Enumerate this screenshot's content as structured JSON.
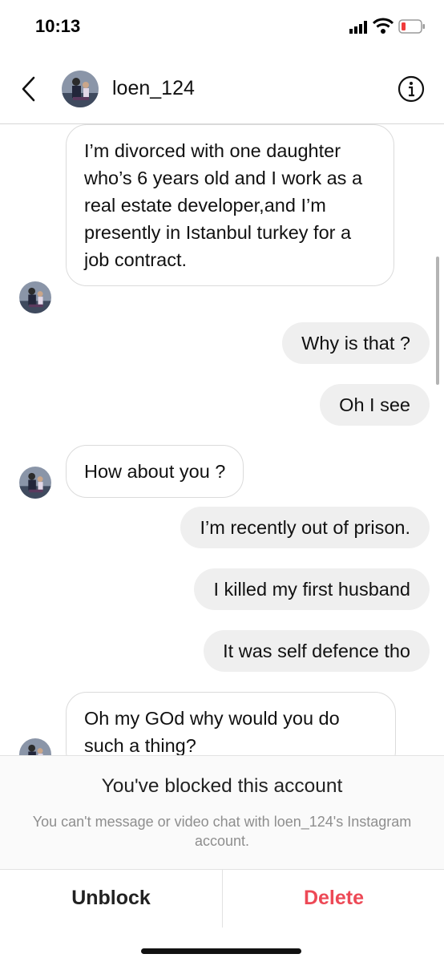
{
  "status_bar": {
    "time": "10:13",
    "icons": [
      "signal-icon",
      "wifi-icon",
      "battery-low-icon"
    ],
    "battery_color": "#f03b3b"
  },
  "header": {
    "username": "loen_124",
    "back_icon": "chevron-left-icon",
    "info_icon": "info-icon"
  },
  "messages": [
    {
      "from": "them",
      "text": "I’m divorced with one daughter who’s 6 years old and I work as a  real estate developer,and I’m presently in Istanbul turkey for a job contract."
    },
    {
      "from": "me",
      "text": "Why is that ?"
    },
    {
      "from": "me",
      "text": "Oh I see"
    },
    {
      "from": "them",
      "text": "How about you ?"
    },
    {
      "from": "me",
      "text": "I’m recently out of prison."
    },
    {
      "from": "me",
      "text": "I killed my first husband"
    },
    {
      "from": "me",
      "text": "It was self defence tho"
    },
    {
      "from": "them",
      "text": "Oh my GOd why would you do such a thing?"
    }
  ],
  "blocked": {
    "title": "You've blocked this account",
    "subtitle": "You can't message or video chat with loen_124's Instagram account."
  },
  "actions": {
    "unblock": "Unblock",
    "delete": "Delete",
    "delete_color": "#ed4956"
  }
}
